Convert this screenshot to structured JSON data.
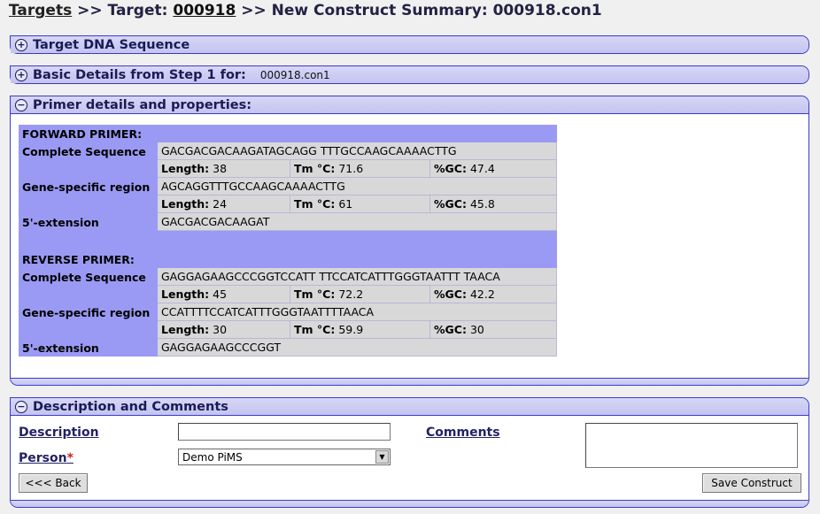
{
  "breadcrumb": {
    "targets_link": "Targets",
    "sep1": " >> Target: ",
    "target_link": "000918",
    "sep2": " >> New Construct Summary: 000918.con1"
  },
  "panels": {
    "target_dna": {
      "title": "Target DNA Sequence",
      "toggle": "+"
    },
    "basic_details": {
      "title": "Basic Details from Step 1 for:",
      "value": "000918.con1",
      "toggle": "+"
    },
    "primer": {
      "title": "Primer details and properties:",
      "toggle": "−"
    },
    "description": {
      "title": "Description and Comments",
      "toggle": "−"
    }
  },
  "primers": {
    "labels": {
      "complete": "Complete Sequence",
      "gene_specific": "Gene-specific region",
      "extension": "5'-extension",
      "length": "Length:",
      "tm": "Tm °C:",
      "gc": "%GC:"
    },
    "forward": {
      "heading": "FORWARD PRIMER:",
      "complete_sequence": "GACGACGACAAGATAGCAGG TTTGCCAAGCAAAACTTG",
      "complete_length": "38",
      "complete_tm": "71.6",
      "complete_gc": "47.4",
      "gene_sequence": "AGCAGGTTTGCCAAGCAAAACTTG",
      "gene_length": "24",
      "gene_tm": "61",
      "gene_gc": "45.8",
      "extension": "GACGACGACAAGAT"
    },
    "reverse": {
      "heading": "REVERSE PRIMER:",
      "complete_sequence": "GAGGAGAAGCCCGGTCCATT TTCCATCATTTGGGTAATTT TAACA",
      "complete_length": "45",
      "complete_tm": "72.2",
      "complete_gc": "42.2",
      "gene_sequence": "CCATTTTCCATCATTTGGGTAATTTTAACA",
      "gene_length": "30",
      "gene_tm": "59.9",
      "gene_gc": "30",
      "extension": "GAGGAGAAGCCCGGT"
    }
  },
  "form": {
    "description_label": "Description",
    "description_value": "",
    "comments_label": "Comments",
    "comments_value": "",
    "person_label": "Person",
    "person_required": "*",
    "person_value": "Demo PiMS"
  },
  "buttons": {
    "back": "<<< Back",
    "save": "Save Construct"
  }
}
